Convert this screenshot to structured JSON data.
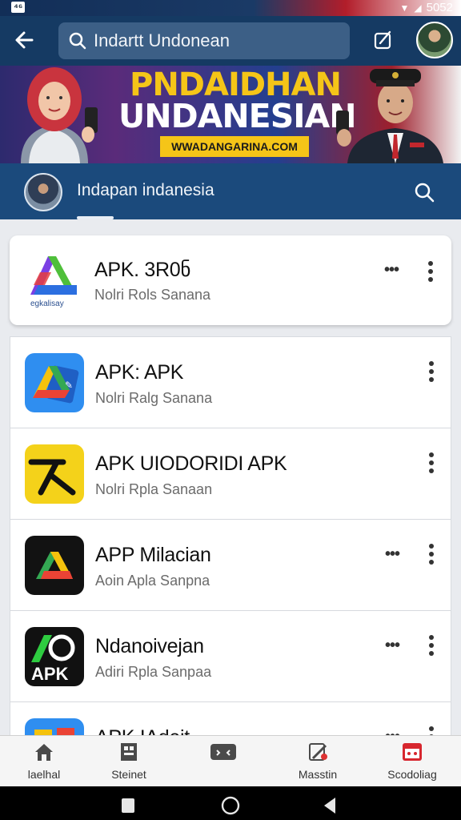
{
  "status_bar": {
    "left_badge": "⁴⁶",
    "time": "5052"
  },
  "app_bar": {
    "search_text": "Indartt Undonean"
  },
  "banner": {
    "title_line1": "PNDAIDHAN",
    "title_line2": "UNDANESIAN",
    "url": "WWADANGARINA.COM"
  },
  "sub_bar": {
    "title": "Indapan indanesia"
  },
  "first_card": {
    "title": "APK. 3R0ნ",
    "subtitle": "Nolri Rols Sanana",
    "icon_caption": "egkalisay"
  },
  "apps": [
    {
      "title": "APK: APK",
      "subtitle": "Nolri Ralg Sanana",
      "has_more_h": false
    },
    {
      "title": "APK UIODORIDI APK",
      "subtitle": "Nolri Rpla Sanaan",
      "has_more_h": false
    },
    {
      "title": "APP Milacian",
      "subtitle": "Aoin Apla Sanpna",
      "has_more_h": true
    },
    {
      "title": "Ndanoivejan",
      "subtitle": "Adiri Rpla Sanpaa",
      "has_more_h": true
    },
    {
      "title": "APK IAdeit",
      "subtitle": "",
      "has_more_h": true
    }
  ],
  "bottom_nav": [
    {
      "label": "laelhal",
      "icon": "home-icon"
    },
    {
      "label": "Steinet",
      "icon": "store-icon"
    },
    {
      "label": "",
      "icon": "gamepad-icon"
    },
    {
      "label": "Masstin",
      "icon": "tools-icon"
    },
    {
      "label": "Scodoliag",
      "icon": "calendar-icon"
    }
  ]
}
